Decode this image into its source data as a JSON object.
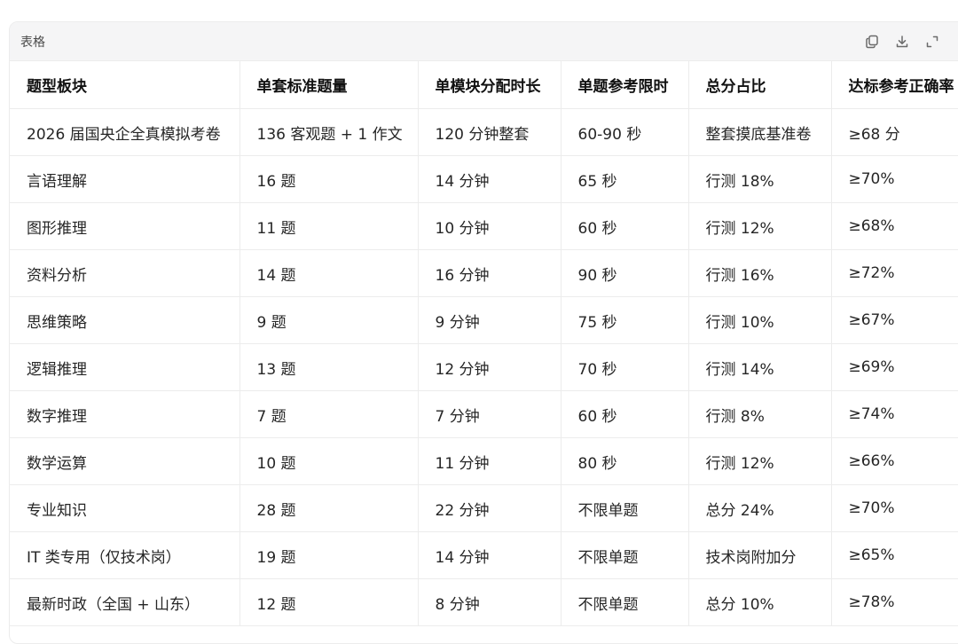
{
  "panel": {
    "title": "表格"
  },
  "icons": {
    "copy": "copy-icon",
    "download": "download-icon",
    "expand": "expand-icon"
  },
  "table": {
    "headers": [
      "题型板块",
      "单套标准题量",
      "单模块分配时长",
      "单题参考限时",
      "总分占比",
      "达标参考正确率"
    ],
    "rows": [
      [
        "2026 届国央企全真模拟考卷",
        "136 客观题 + 1 作文",
        "120 分钟整套",
        "60-90 秒",
        "整套摸底基准卷",
        "≥68 分"
      ],
      [
        "言语理解",
        "16 题",
        "14 分钟",
        "65 秒",
        "行测 18%",
        "≥70%"
      ],
      [
        "图形推理",
        "11 题",
        "10 分钟",
        "60 秒",
        "行测 12%",
        "≥68%"
      ],
      [
        "资料分析",
        "14 题",
        "16 分钟",
        "90 秒",
        "行测 16%",
        "≥72%"
      ],
      [
        "思维策略",
        "9 题",
        "9 分钟",
        "75 秒",
        "行测 10%",
        "≥67%"
      ],
      [
        "逻辑推理",
        "13 题",
        "12 分钟",
        "70 秒",
        "行测 14%",
        "≥69%"
      ],
      [
        "数字推理",
        "7 题",
        "7 分钟",
        "60 秒",
        "行测 8%",
        "≥74%"
      ],
      [
        "数学运算",
        "10 题",
        "11 分钟",
        "80 秒",
        "行测 12%",
        "≥66%"
      ],
      [
        "专业知识",
        "28 题",
        "22 分钟",
        "不限单题",
        "总分 24%",
        "≥70%"
      ],
      [
        "IT 类专用（仅技术岗）",
        "19 题",
        "14 分钟",
        "不限单题",
        "技术岗附加分",
        "≥65%"
      ],
      [
        "最新时政（全国 + 山东）",
        "12 题",
        "8 分钟",
        "不限单题",
        "总分 10%",
        "≥78%"
      ]
    ]
  }
}
